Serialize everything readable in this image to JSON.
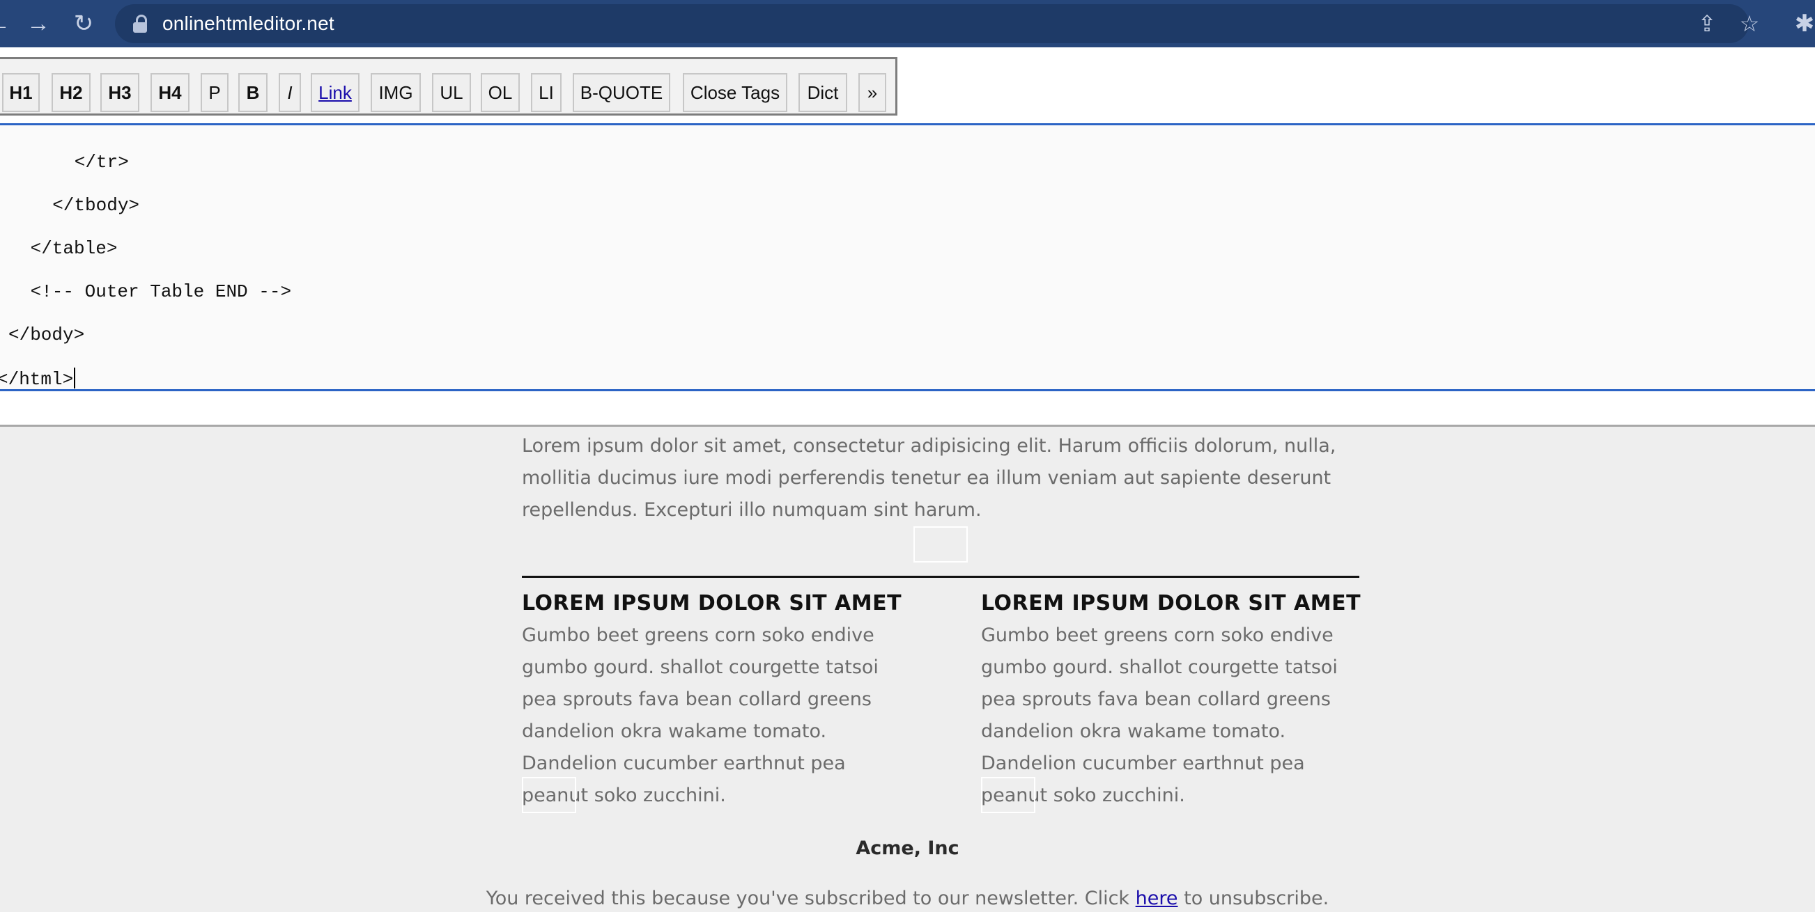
{
  "browser": {
    "url": "onlinehtmleditor.net",
    "icons": [
      "back-arrow-icon",
      "forward-arrow-icon",
      "reload-icon",
      "lock-icon",
      "share-icon",
      "star-icon",
      "extensions-icon"
    ]
  },
  "toolbar": {
    "buttons": [
      "H1",
      "H2",
      "H3",
      "H4",
      "P",
      "B",
      "I",
      "Link",
      "IMG",
      "UL",
      "OL",
      "LI",
      "B-QUOTE",
      "Close Tags",
      "Dict",
      "»"
    ]
  },
  "editor": {
    "lines": [
      "   </tr>",
      "  </tbody>",
      " </table>",
      " <!-- Outer Table END -->",
      "</body>",
      "</html>"
    ]
  },
  "preview": {
    "intro": "Lorem ipsum dolor sit amet, consectetur adipisicing elit. Harum officiis dolorum, nulla, mollitia ducimus iure modi perferendis tenetur ea illum veniam aut sapiente deserunt repellendus. Excepturi illo numquam sint harum.",
    "columns": [
      {
        "heading": "LOREM IPSUM DOLOR SIT AMET",
        "body": "Gumbo beet greens corn soko endive gumbo gourd. shallot courgette tatsoi pea sprouts fava bean collard greens dandelion okra wakame tomato. Dandelion cucumber earthnut pea peanut soko zucchini."
      },
      {
        "heading": "LOREM IPSUM DOLOR SIT AMET",
        "body": "Gumbo beet greens corn soko endive gumbo gourd. shallot courgette tatsoi pea sprouts fava bean collard greens dandelion okra wakame tomato. Dandelion cucumber earthnut pea peanut soko zucchini."
      }
    ],
    "company": "Acme, Inc",
    "unsubscribe_prefix": "You received this because you've subscribed to our newsletter. Click",
    "unsubscribe_link": "here",
    "unsubscribe_suffix": "to unsubscribe."
  }
}
